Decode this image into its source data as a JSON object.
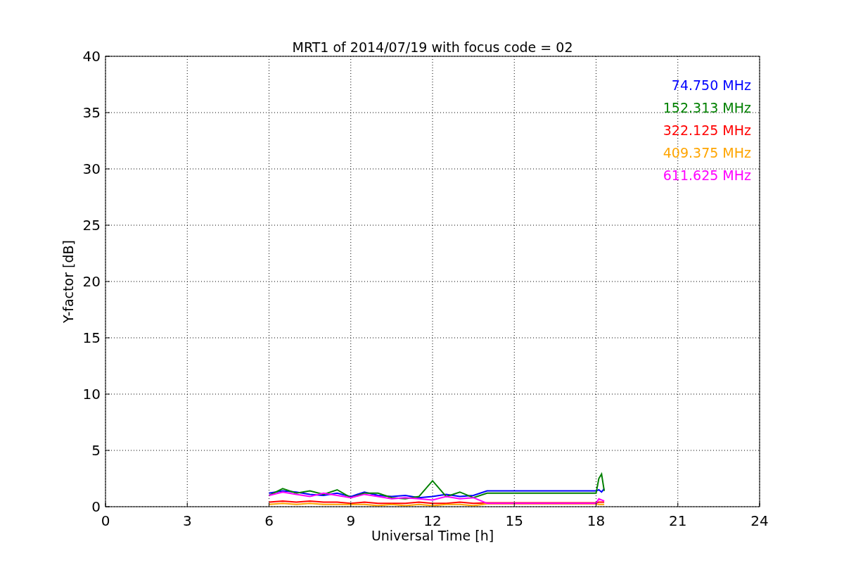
{
  "figure": {
    "chart_data": {
      "type": "line",
      "title": "MRT1 of 2014/07/19 with focus code = 02",
      "xlabel": "Universal Time [h]",
      "ylabel": "Y-factor [dB]",
      "x": [
        6,
        6.5,
        7,
        7.5,
        8,
        8.5,
        9,
        9.5,
        10,
        10.5,
        11,
        11.5,
        12,
        12.5,
        13,
        13.5,
        14,
        18,
        18.1,
        18.2,
        18.3
      ],
      "series": [
        {
          "name": "74.750 MHz",
          "color": "#0000ff",
          "values": [
            1.2,
            1.4,
            1.3,
            1.1,
            1.0,
            1.2,
            0.9,
            1.3,
            1.0,
            0.9,
            1.0,
            0.8,
            0.9,
            1.1,
            0.9,
            1.0,
            1.4,
            1.4,
            1.5,
            1.3,
            1.6
          ]
        },
        {
          "name": "152.313 MHz",
          "color": "#008000",
          "values": [
            1.0,
            1.6,
            1.2,
            1.4,
            1.1,
            1.5,
            0.8,
            1.2,
            1.2,
            0.8,
            0.7,
            0.9,
            2.3,
            0.9,
            1.3,
            0.8,
            1.2,
            1.2,
            2.5,
            2.9,
            1.4
          ]
        },
        {
          "name": "322.125 MHz",
          "color": "#ff0000",
          "values": [
            0.4,
            0.5,
            0.4,
            0.5,
            0.4,
            0.4,
            0.3,
            0.4,
            0.3,
            0.3,
            0.3,
            0.4,
            0.3,
            0.3,
            0.4,
            0.3,
            0.35,
            0.35,
            0.4,
            0.4,
            0.4
          ]
        },
        {
          "name": "409.375 MHz",
          "color": "#ffa500",
          "values": [
            0.2,
            0.3,
            0.2,
            0.3,
            0.2,
            0.2,
            0.2,
            0.2,
            0.1,
            0.2,
            0.1,
            0.2,
            0.1,
            0.2,
            0.2,
            0.1,
            0.25,
            0.25,
            0.2,
            0.2,
            0.2
          ]
        },
        {
          "name": "611.625 MHz",
          "color": "#ff00ff",
          "values": [
            1.0,
            1.3,
            1.1,
            0.9,
            1.2,
            1.0,
            0.8,
            1.1,
            0.9,
            0.7,
            0.8,
            0.7,
            0.6,
            0.9,
            0.7,
            0.8,
            0.3,
            0.3,
            0.7,
            0.6,
            0.5
          ]
        }
      ],
      "xlim": [
        0,
        24
      ],
      "ylim": [
        0,
        40
      ],
      "xticks": [
        0,
        3,
        6,
        9,
        12,
        15,
        18,
        21,
        24
      ],
      "yticks": [
        0,
        5,
        10,
        15,
        20,
        25,
        30,
        35,
        40
      ],
      "grid": true
    }
  }
}
